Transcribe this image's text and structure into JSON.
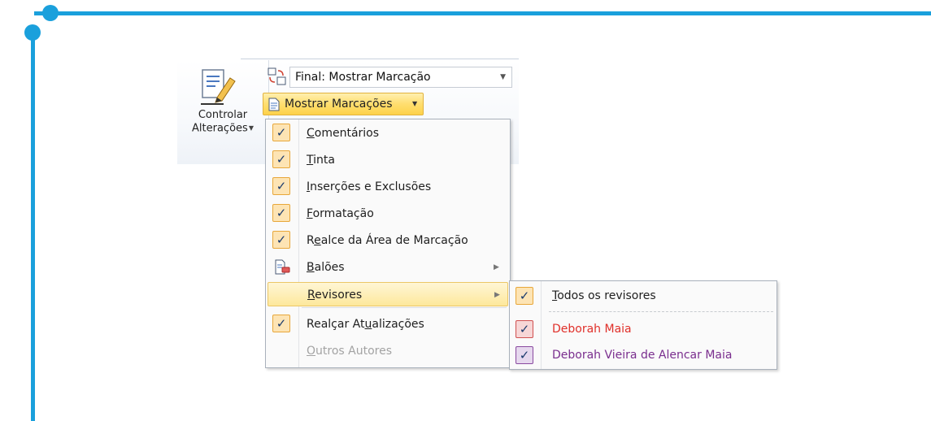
{
  "ribbon": {
    "track_changes_label_line1": "Controlar",
    "track_changes_label_line2": "Alterações",
    "display_combo_value": "Final: Mostrar Marcação",
    "show_markup_label": "Mostrar Marcações"
  },
  "menu": {
    "items": [
      {
        "label": "Comentários",
        "access_key": "C",
        "checked": true
      },
      {
        "label": "Tinta",
        "access_key": "T",
        "checked": true
      },
      {
        "label": "Inserções e Exclusões",
        "access_key": "I",
        "checked": true
      },
      {
        "label": "Formatação",
        "access_key": "F",
        "checked": true
      },
      {
        "label": "Realce da Área de Marcação",
        "access_key": "e",
        "checked": true
      },
      {
        "label": "Balões",
        "access_key": "B",
        "icon": "balloons-icon",
        "submenu": true
      },
      {
        "label": "Revisores",
        "access_key": "R",
        "submenu": true,
        "highlighted": true
      },
      {
        "label": "Realçar Atualizações",
        "access_key": "u",
        "checked": true
      },
      {
        "label": "Outros Autores",
        "access_key": "O",
        "disabled": true
      }
    ]
  },
  "reviewers_submenu": {
    "items": [
      {
        "label": "Todos os revisores",
        "access_key": "T",
        "checked": true,
        "color": "#1e1e1e",
        "check_bg": "#fde4b4",
        "check_border": "#e8a73a"
      },
      {
        "label": "Deborah Maia",
        "checked": true,
        "color": "#e0302a",
        "check_bg": "#f7d6d6",
        "check_border": "#d05050"
      },
      {
        "label": "Deborah Vieira de Alencar Maia",
        "checked": true,
        "color": "#7a2e8e",
        "check_bg": "#e6d8ee",
        "check_border": "#8a4aa0"
      }
    ]
  },
  "check_glyph": "✓",
  "colors": {
    "frame": "#1aa0dc",
    "highlight": "#fde89c"
  }
}
